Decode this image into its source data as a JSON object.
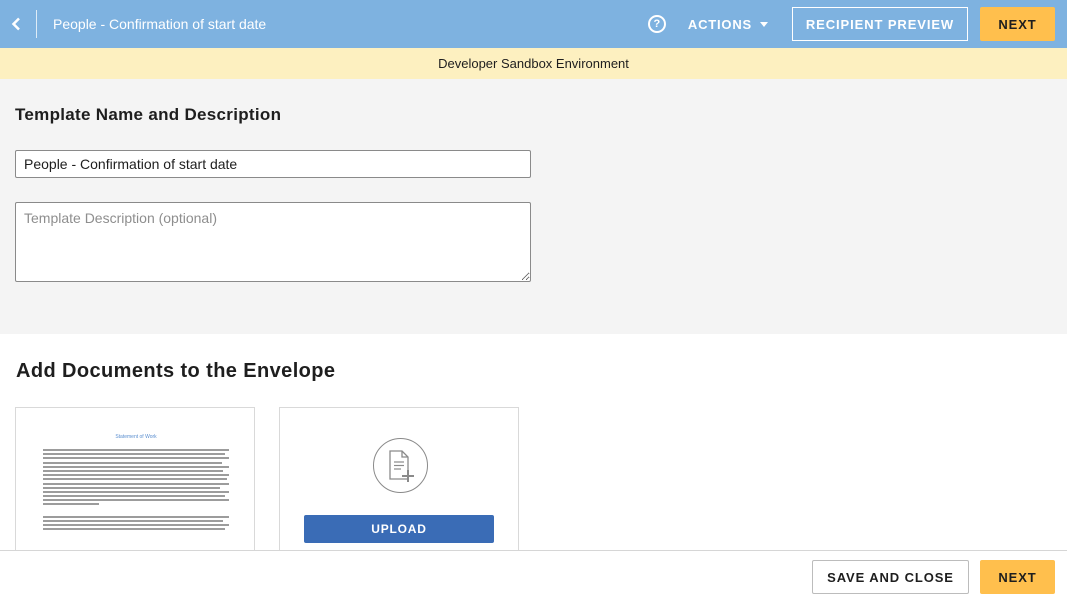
{
  "header": {
    "title": "People - Confirmation of start date",
    "help_icon": "question-circle-icon",
    "actions_label": "ACTIONS",
    "recipient_preview_label": "RECIPIENT PREVIEW",
    "next_label": "NEXT"
  },
  "banner": {
    "text": "Developer Sandbox Environment"
  },
  "template": {
    "heading": "Template Name and Description",
    "name_value": "People - Confirmation of start date",
    "description_placeholder": "Template Description (optional)"
  },
  "documents": {
    "heading": "Add Documents to the Envelope",
    "doc_thumbnail_title": "Statement of Work",
    "upload_icon": "add-document-icon",
    "upload_label": "UPLOAD"
  },
  "footer": {
    "save_close_label": "SAVE AND CLOSE",
    "next_label": "NEXT"
  },
  "colors": {
    "topbar": "#7eb2e0",
    "accent": "#ffbf4d",
    "banner": "#fdf0c0",
    "upload": "#3a6cb6"
  }
}
